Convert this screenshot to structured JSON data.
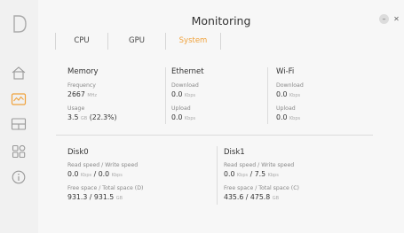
{
  "window": {
    "title": "Monitoring",
    "minimize_label": "–",
    "close_label": "✕"
  },
  "colors": {
    "accent": "#f0a23c",
    "text": "#333333",
    "muted": "#888888"
  },
  "sidebar": {
    "logo": "D",
    "items": [
      {
        "icon": "home-icon",
        "active": false
      },
      {
        "icon": "monitor-chart-icon",
        "active": true
      },
      {
        "icon": "layout-icon",
        "active": false
      },
      {
        "icon": "apps-icon",
        "active": false
      },
      {
        "icon": "info-icon",
        "active": false
      }
    ]
  },
  "tabs": [
    {
      "label": "CPU",
      "active": false
    },
    {
      "label": "GPU",
      "active": false
    },
    {
      "label": "System",
      "active": true
    }
  ],
  "memory": {
    "title": "Memory",
    "frequency_label": "Frequency",
    "frequency_value": "2667",
    "frequency_unit": "MHz",
    "usage_label": "Usage",
    "usage_value": "3.5",
    "usage_unit": "GB",
    "usage_pct": "(22.3%)"
  },
  "ethernet": {
    "title": "Ethernet",
    "download_label": "Download",
    "download_value": "0.0",
    "download_unit": "Kbps",
    "upload_label": "Upload",
    "upload_value": "0.0",
    "upload_unit": "Kbps"
  },
  "wifi": {
    "title": "Wi-Fi",
    "download_label": "Download",
    "download_value": "0.0",
    "download_unit": "Kbps",
    "upload_label": "Upload",
    "upload_value": "0.0",
    "upload_unit": "Kbps"
  },
  "disk0": {
    "title": "Disk0",
    "speed_label": "Read speed / Write speed",
    "read_value": "0.0",
    "read_unit": "Kbps",
    "write_value": "0.0",
    "write_unit": "Kbps",
    "space_label": "Free space / Total space (D)",
    "free_value": "931.3",
    "total_value": "931.5",
    "space_unit": "GB"
  },
  "disk1": {
    "title": "Disk1",
    "speed_label": "Read speed / Write speed",
    "read_value": "0.0",
    "read_unit": "Kbps",
    "write_value": "7.5",
    "write_unit": "Kbps",
    "space_label": "Free space / Total space (C)",
    "free_value": "435.6",
    "total_value": "475.8",
    "space_unit": "GB"
  }
}
